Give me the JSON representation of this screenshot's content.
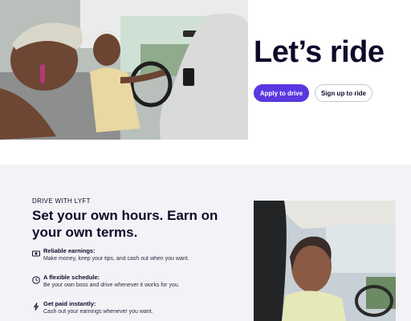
{
  "hero": {
    "title": "Let’s ride",
    "apply_button": "Apply to drive",
    "signup_button": "Sign up to ride",
    "accent_color": "#5a37e0"
  },
  "drive_section": {
    "eyebrow": "DRIVE WITH LYFT",
    "heading": "Set your own hours. Earn on your own terms.",
    "features": [
      {
        "icon": "cash-icon",
        "title": "Reliable earnings:",
        "description": "Make money, keep your tips, and cash out when you want."
      },
      {
        "icon": "clock-icon",
        "title": "A flexible schedule:",
        "description": "Be your own boss and drive whenever it works for you."
      },
      {
        "icon": "lightning-icon",
        "title": "Get paid instantly:",
        "description": "Cash out your earnings whenever you want."
      }
    ]
  }
}
